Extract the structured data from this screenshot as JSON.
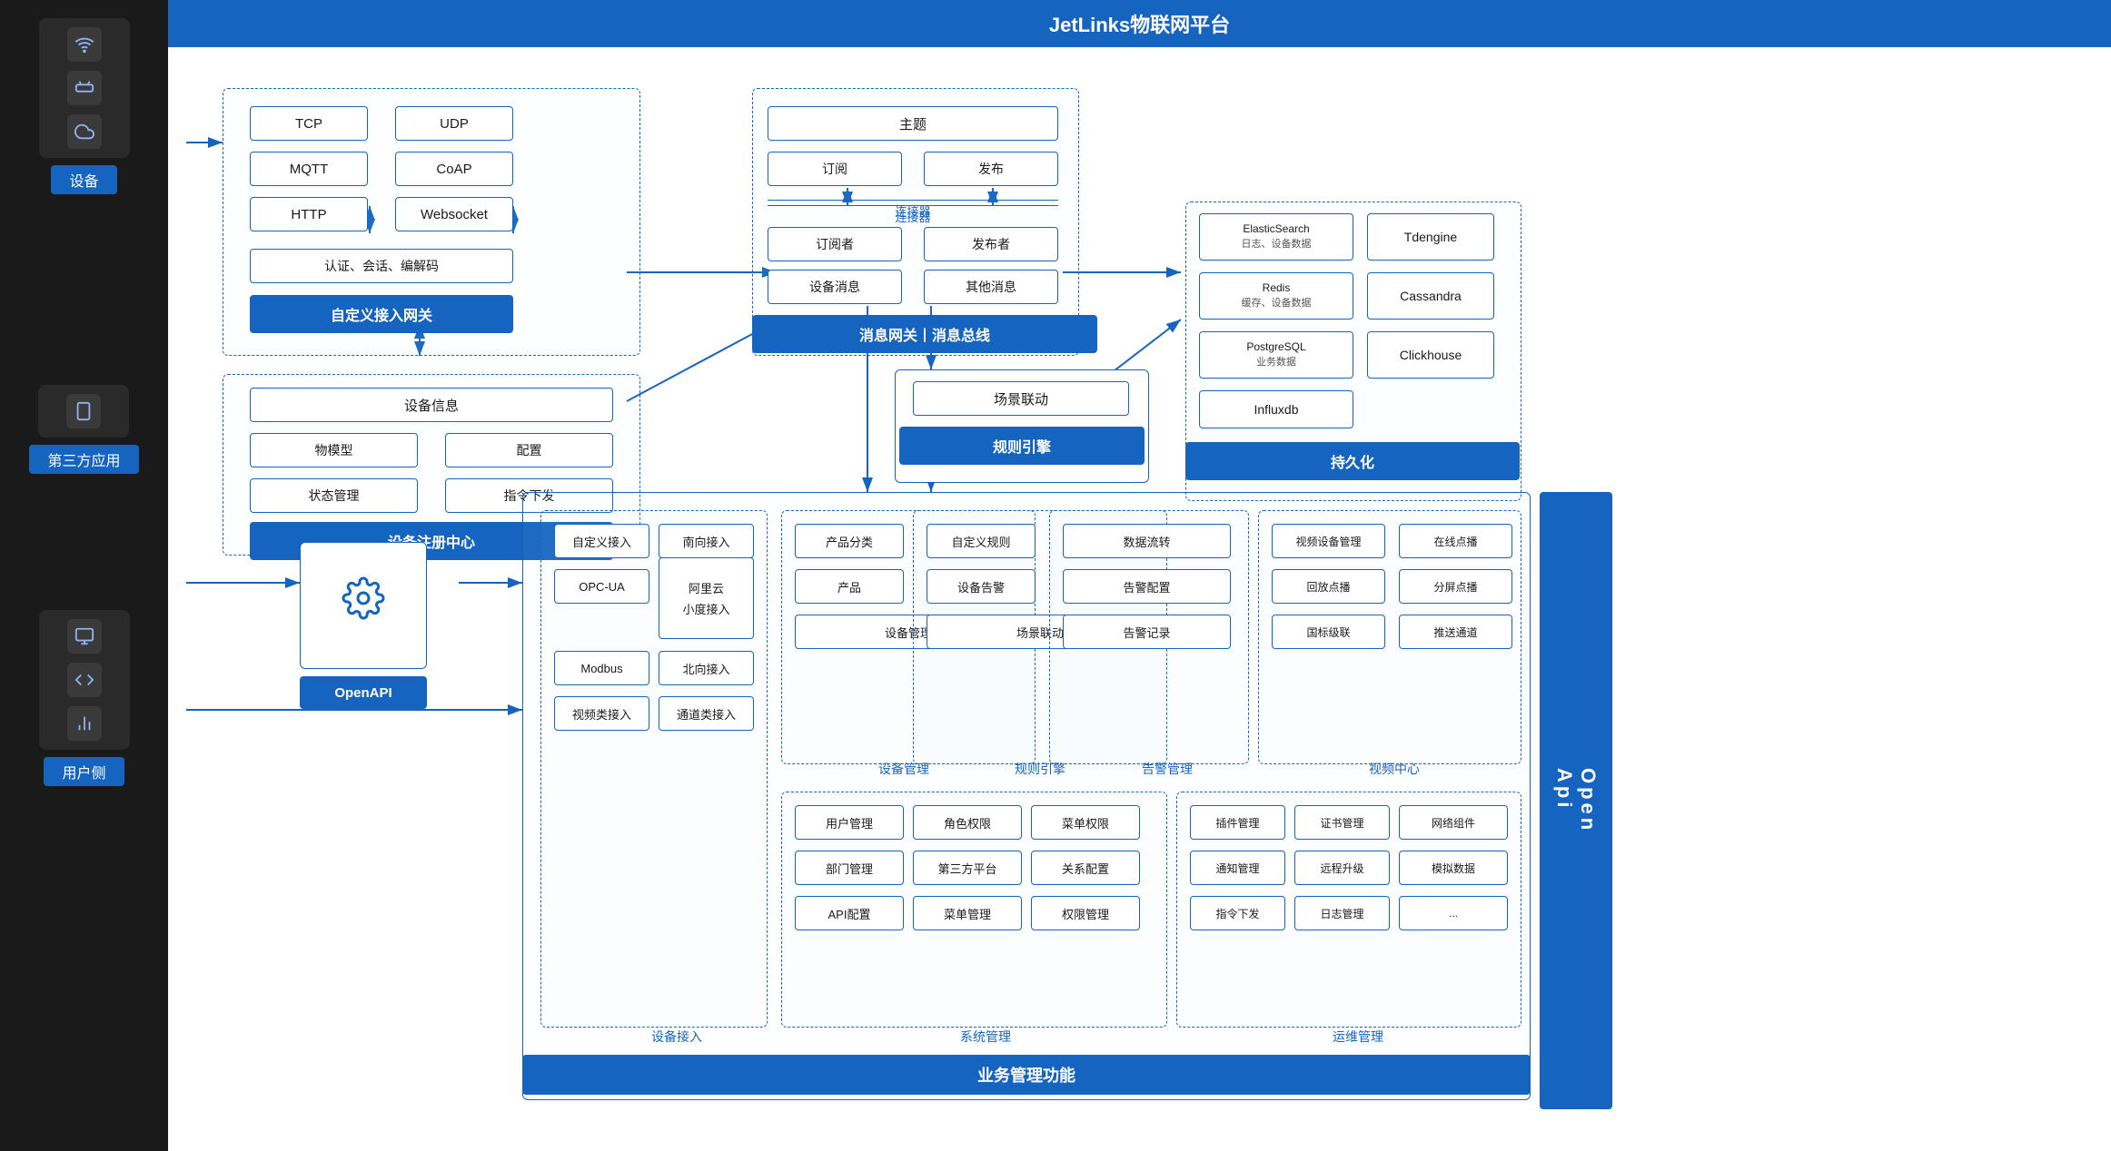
{
  "title": "JetLinks物联网平台",
  "sidebar": {
    "sections": [
      {
        "id": "device",
        "label": "设备",
        "icons": [
          "wifi-icon",
          "router-icon",
          "cloud-icon"
        ]
      },
      {
        "id": "third-party",
        "label": "第三方应用",
        "icons": [
          "mobile-icon"
        ]
      },
      {
        "id": "user-side",
        "label": "用户侧",
        "icons": [
          "monitor-icon",
          "code-icon",
          "chart-icon"
        ]
      }
    ]
  },
  "gateway_section": {
    "protocols": [
      "TCP",
      "UDP",
      "MQTT",
      "CoAP",
      "HTTP",
      "Websocket"
    ],
    "auth": "认证、会话、编解码",
    "gateway_label": "自定义接入网关"
  },
  "device_section": {
    "title": "设备信息",
    "items": [
      "物模型",
      "配置",
      "状态管理",
      "指令下发"
    ],
    "register": "设备注册中心"
  },
  "message_section": {
    "topic": "主题",
    "subscribe": "订阅",
    "publish": "发布",
    "connector_label": "连接器",
    "subscriber": "订阅者",
    "publisher": "发布者",
    "device_msg": "设备消息",
    "other_msg": "其他消息",
    "gateway_label": "消息网关丨消息总线"
  },
  "scene_section": {
    "scene": "场景联动",
    "rule": "规则引擎"
  },
  "storage_section": {
    "items": [
      {
        "name": "ElasticSearch",
        "desc": "日志、设备数据"
      },
      {
        "name": "Tdengine",
        "desc": ""
      },
      {
        "name": "Redis",
        "desc": "缓存、设备数据"
      },
      {
        "name": "Cassandra",
        "desc": ""
      },
      {
        "name": "PostgreSQL",
        "desc": "业务数据"
      },
      {
        "name": "Clickhouse",
        "desc": ""
      },
      {
        "name": "Influxdb",
        "desc": ""
      }
    ],
    "persist_label": "持久化"
  },
  "openapi": {
    "label": "OpenAPI",
    "bar_label": "Open\nApi"
  },
  "device_access": {
    "title": "设备接入",
    "items": [
      "自定义接入",
      "南向接入",
      "OPC-UA",
      "阿里云",
      "小度接入",
      "Modbus",
      "北向接入",
      "视频类接入",
      "通道类接入"
    ]
  },
  "device_mgmt": {
    "title": "设备管理",
    "items": [
      "产品分类",
      "产品",
      "设备管理"
    ]
  },
  "rule_engine": {
    "title": "规则引擎",
    "items": [
      "自定义规则",
      "设备告警",
      "场景联动"
    ]
  },
  "alarm_mgmt": {
    "title": "告警管理",
    "items": [
      "数据流转",
      "告警配置",
      "告警记录"
    ]
  },
  "video_center": {
    "title": "视频中心",
    "items": [
      "视频设备管理",
      "在线点播",
      "回放点播",
      "分屏点播",
      "国标级联",
      "推送通道"
    ]
  },
  "system_mgmt": {
    "title": "系统管理",
    "items": [
      "用户管理",
      "角色权限",
      "菜单权限",
      "部门管理",
      "第三方平台",
      "关系配置",
      "API配置",
      "菜单管理",
      "权限管理"
    ]
  },
  "ops_mgmt": {
    "title": "运维管理",
    "items": [
      "插件管理",
      "证书管理",
      "网络组件",
      "通知管理",
      "远程升级",
      "模拟数据",
      "指令下发",
      "日志管理",
      "..."
    ]
  },
  "business_label": "业务管理功能"
}
